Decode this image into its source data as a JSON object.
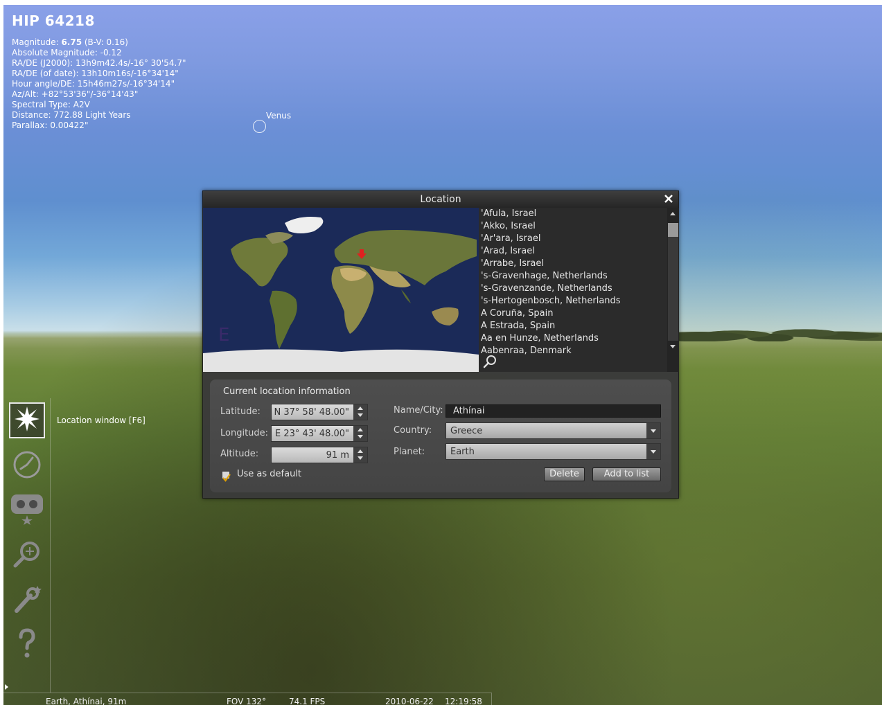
{
  "star": {
    "title": "HIP 64218",
    "magnitude_label": "Magnitude: ",
    "magnitude_value": "6.75",
    "magnitude_suffix": " (B-V: 0.16)",
    "lines": [
      "Absolute Magnitude: -0.12",
      "RA/DE (J2000): 13h9m42.4s/-16° 30'54.7\"",
      "RA/DE (of date): 13h10m16s/-16°34'14\"",
      "Hour angle/DE: 15h46m27s/-16°34'14\"",
      "Az/Alt: +82°53'36\"/-36°14'43\"",
      "Spectral Type: A2V",
      "Distance: 772.88 Light Years",
      "Parallax: 0.00422\""
    ]
  },
  "planet_label": "Venus",
  "tooltip": "Location window  [F6]",
  "sidebar": {
    "buttons": [
      {
        "name": "location-window-button",
        "icon": "star-burst-icon"
      },
      {
        "name": "date-time-window-button",
        "icon": "clock-icon"
      },
      {
        "name": "sky-view-window-button",
        "icon": "eye-mask-icon"
      },
      {
        "name": "search-window-button",
        "icon": "magnifier-icon"
      },
      {
        "name": "configuration-window-button",
        "icon": "wrench-icon"
      },
      {
        "name": "help-window-button",
        "icon": "question-mark-icon"
      }
    ]
  },
  "statusbar": {
    "location": "Earth, Athínai, 91m",
    "fov": "FOV 132°",
    "fps": "74.1 FPS",
    "date": "2010-06-22",
    "time": "12:19:58"
  },
  "dialog": {
    "title": "Location",
    "cities": [
      "'Afula, Israel",
      "'Akko, Israel",
      "'Ar'ara, Israel",
      "'Arad, Israel",
      "'Arrabe, Israel",
      "'s-Gravenhage, Netherlands",
      "'s-Gravenzande, Netherlands",
      "'s-Hertogenbosch, Netherlands",
      "A Coruña, Spain",
      "A Estrada, Spain",
      "Aa en Hunze, Netherlands",
      "Aabenraa, Denmark"
    ],
    "info": {
      "heading": "Current location information",
      "latitude_label": "Latitude:",
      "latitude_value": "N 37° 58' 48.00\"",
      "longitude_label": "Longitude:",
      "longitude_value": "E 23° 43' 48.00\"",
      "altitude_label": "Altitude:",
      "altitude_value": "91 m",
      "name_label": "Name/City:",
      "name_value": "Athínai",
      "country_label": "Country:",
      "country_value": "Greece",
      "planet_label": "Planet:",
      "planet_value": "Earth",
      "use_default_label": "Use as default",
      "use_default_checked": true,
      "delete_label": "Delete",
      "add_label": "Add to list"
    }
  },
  "colors": {
    "marker": "#e02020",
    "checkmark": "#e0a000"
  }
}
